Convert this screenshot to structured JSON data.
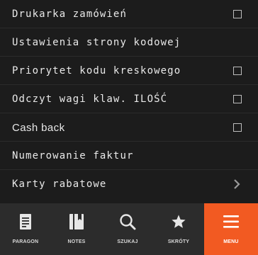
{
  "settings": {
    "items": [
      {
        "label": "Drukarka zamówień",
        "control": "checkbox",
        "checked": false,
        "font": "mono"
      },
      {
        "label": "Ustawienia strony kodowej",
        "control": "none",
        "font": "mono"
      },
      {
        "label": "Priorytet kodu kreskowego",
        "control": "checkbox",
        "checked": false,
        "font": "mono"
      },
      {
        "label": "Odczyt wagi klaw. ILOŚĆ",
        "control": "checkbox",
        "checked": false,
        "font": "mono"
      },
      {
        "label": "Cash back",
        "control": "checkbox",
        "checked": false,
        "font": "sans"
      },
      {
        "label": "Numerowanie faktur",
        "control": "none",
        "font": "mono"
      },
      {
        "label": "Karty rabatowe",
        "control": "chevron",
        "font": "mono"
      }
    ]
  },
  "bottom_nav": {
    "tabs": [
      {
        "label": "PARAGON",
        "icon": "receipt-icon"
      },
      {
        "label": "NOTES",
        "icon": "notebook-icon"
      },
      {
        "label": "SZUKAJ",
        "icon": "search-icon"
      },
      {
        "label": "SKRÓTY",
        "icon": "star-icon"
      },
      {
        "label": "MENU",
        "icon": "hamburger-menu-icon",
        "active": true
      }
    ]
  },
  "colors": {
    "background": "#1c1c1c",
    "nav_background": "#2c2c2c",
    "accent": "#f25a22",
    "text": "#e9e9e9"
  }
}
